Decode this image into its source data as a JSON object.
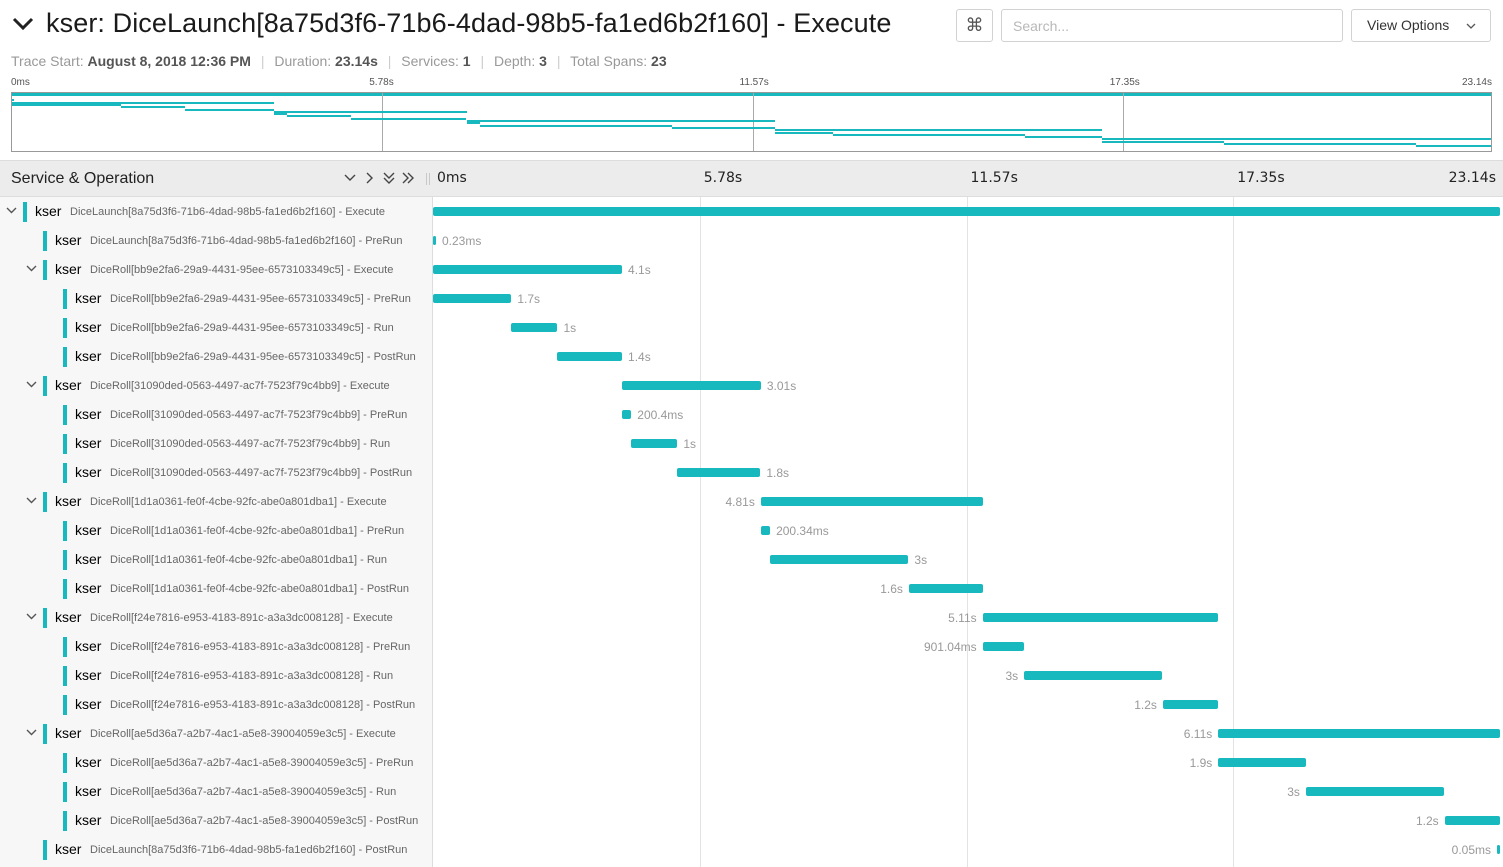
{
  "header": {
    "title": "kser: DiceLaunch[8a75d3f6-71b6-4dad-98b5-fa1ed6b2f160] - Execute",
    "cmd_glyph": "⌘",
    "search_placeholder": "Search...",
    "view_options_label": "View Options"
  },
  "meta": {
    "trace_start_label": "Trace Start:",
    "trace_start_value": "August 8, 2018 12:36 PM",
    "duration_label": "Duration:",
    "duration_value": "23.14s",
    "services_label": "Services:",
    "services_value": "1",
    "depth_label": "Depth:",
    "depth_value": "3",
    "total_spans_label": "Total Spans:",
    "total_spans_value": "23",
    "separator": "|"
  },
  "timeline": {
    "service_operation_label": "Service & Operation",
    "total_duration_s": 23.14,
    "ticks": [
      {
        "label": "0ms",
        "value_s": 0
      },
      {
        "label": "5.78s",
        "value_s": 5.785
      },
      {
        "label": "11.57s",
        "value_s": 11.57
      },
      {
        "label": "17.35s",
        "value_s": 17.355
      },
      {
        "label": "23.14s",
        "value_s": 23.14
      }
    ],
    "accent_color": "#17b8be"
  },
  "spans": [
    {
      "service": "kser",
      "operation": "DiceLaunch[8a75d3f6-71b6-4dad-98b5-fa1ed6b2f160] - Execute",
      "depth": 0,
      "has_children": true,
      "start_s": 0,
      "duration_s": 23.14,
      "label": ""
    },
    {
      "service": "kser",
      "operation": "DiceLaunch[8a75d3f6-71b6-4dad-98b5-fa1ed6b2f160] - PreRun",
      "depth": 1,
      "has_children": false,
      "start_s": 0,
      "duration_s": 0.00023,
      "label": "0.23ms"
    },
    {
      "service": "kser",
      "operation": "DiceRoll[bb9e2fa6-29a9-4431-95ee-6573103349c5] - Execute",
      "depth": 1,
      "has_children": true,
      "start_s": 0,
      "duration_s": 4.1,
      "label": "4.1s"
    },
    {
      "service": "kser",
      "operation": "DiceRoll[bb9e2fa6-29a9-4431-95ee-6573103349c5] - PreRun",
      "depth": 2,
      "has_children": false,
      "start_s": 0,
      "duration_s": 1.7,
      "label": "1.7s"
    },
    {
      "service": "kser",
      "operation": "DiceRoll[bb9e2fa6-29a9-4431-95ee-6573103349c5] - Run",
      "depth": 2,
      "has_children": false,
      "start_s": 1.7,
      "duration_s": 1.0,
      "label": "1s"
    },
    {
      "service": "kser",
      "operation": "DiceRoll[bb9e2fa6-29a9-4431-95ee-6573103349c5] - PostRun",
      "depth": 2,
      "has_children": false,
      "start_s": 2.7,
      "duration_s": 1.4,
      "label": "1.4s"
    },
    {
      "service": "kser",
      "operation": "DiceRoll[31090ded-0563-4497-ac7f-7523f79c4bb9] - Execute",
      "depth": 1,
      "has_children": true,
      "start_s": 4.1,
      "duration_s": 3.01,
      "label": "3.01s"
    },
    {
      "service": "kser",
      "operation": "DiceRoll[31090ded-0563-4497-ac7f-7523f79c4bb9] - PreRun",
      "depth": 2,
      "has_children": false,
      "start_s": 4.1,
      "duration_s": 0.2004,
      "label": "200.4ms"
    },
    {
      "service": "kser",
      "operation": "DiceRoll[31090ded-0563-4497-ac7f-7523f79c4bb9] - Run",
      "depth": 2,
      "has_children": false,
      "start_s": 4.3,
      "duration_s": 1.0,
      "label": "1s"
    },
    {
      "service": "kser",
      "operation": "DiceRoll[31090ded-0563-4497-ac7f-7523f79c4bb9] - PostRun",
      "depth": 2,
      "has_children": false,
      "start_s": 5.3,
      "duration_s": 1.8,
      "label": "1.8s"
    },
    {
      "service": "kser",
      "operation": "DiceRoll[1d1a0361-fe0f-4cbe-92fc-abe0a801dba1] - Execute",
      "depth": 1,
      "has_children": true,
      "start_s": 7.11,
      "duration_s": 4.81,
      "label": "4.81s"
    },
    {
      "service": "kser",
      "operation": "DiceRoll[1d1a0361-fe0f-4cbe-92fc-abe0a801dba1] - PreRun",
      "depth": 2,
      "has_children": false,
      "start_s": 7.11,
      "duration_s": 0.20034,
      "label": "200.34ms"
    },
    {
      "service": "kser",
      "operation": "DiceRoll[1d1a0361-fe0f-4cbe-92fc-abe0a801dba1] - Run",
      "depth": 2,
      "has_children": false,
      "start_s": 7.31,
      "duration_s": 3.0,
      "label": "3s"
    },
    {
      "service": "kser",
      "operation": "DiceRoll[1d1a0361-fe0f-4cbe-92fc-abe0a801dba1] - PostRun",
      "depth": 2,
      "has_children": false,
      "start_s": 10.32,
      "duration_s": 1.6,
      "label": "1.6s"
    },
    {
      "service": "kser",
      "operation": "DiceRoll[f24e7816-e953-4183-891c-a3a3dc008128] - Execute",
      "depth": 1,
      "has_children": true,
      "start_s": 11.92,
      "duration_s": 5.11,
      "label": "5.11s"
    },
    {
      "service": "kser",
      "operation": "DiceRoll[f24e7816-e953-4183-891c-a3a3dc008128] - PreRun",
      "depth": 2,
      "has_children": false,
      "start_s": 11.92,
      "duration_s": 0.90104,
      "label": "901.04ms"
    },
    {
      "service": "kser",
      "operation": "DiceRoll[f24e7816-e953-4183-891c-a3a3dc008128] - Run",
      "depth": 2,
      "has_children": false,
      "start_s": 12.82,
      "duration_s": 3.0,
      "label": "3s"
    },
    {
      "service": "kser",
      "operation": "DiceRoll[f24e7816-e953-4183-891c-a3a3dc008128] - PostRun",
      "depth": 2,
      "has_children": false,
      "start_s": 15.83,
      "duration_s": 1.2,
      "label": "1.2s"
    },
    {
      "service": "kser",
      "operation": "DiceRoll[ae5d36a7-a2b7-4ac1-a5e8-39004059e3c5] - Execute",
      "depth": 1,
      "has_children": true,
      "start_s": 17.03,
      "duration_s": 6.11,
      "label": "6.11s"
    },
    {
      "service": "kser",
      "operation": "DiceRoll[ae5d36a7-a2b7-4ac1-a5e8-39004059e3c5] - PreRun",
      "depth": 2,
      "has_children": false,
      "start_s": 17.03,
      "duration_s": 1.9,
      "label": "1.9s"
    },
    {
      "service": "kser",
      "operation": "DiceRoll[ae5d36a7-a2b7-4ac1-a5e8-39004059e3c5] - Run",
      "depth": 2,
      "has_children": false,
      "start_s": 18.93,
      "duration_s": 3.0,
      "label": "3s"
    },
    {
      "service": "kser",
      "operation": "DiceRoll[ae5d36a7-a2b7-4ac1-a5e8-39004059e3c5] - PostRun",
      "depth": 2,
      "has_children": false,
      "start_s": 21.94,
      "duration_s": 1.2,
      "label": "1.2s"
    },
    {
      "service": "kser",
      "operation": "DiceLaunch[8a75d3f6-71b6-4dad-98b5-fa1ed6b2f160] - PostRun",
      "depth": 1,
      "has_children": false,
      "start_s": 23.14,
      "duration_s": 5e-05,
      "label": "0.05ms"
    }
  ]
}
